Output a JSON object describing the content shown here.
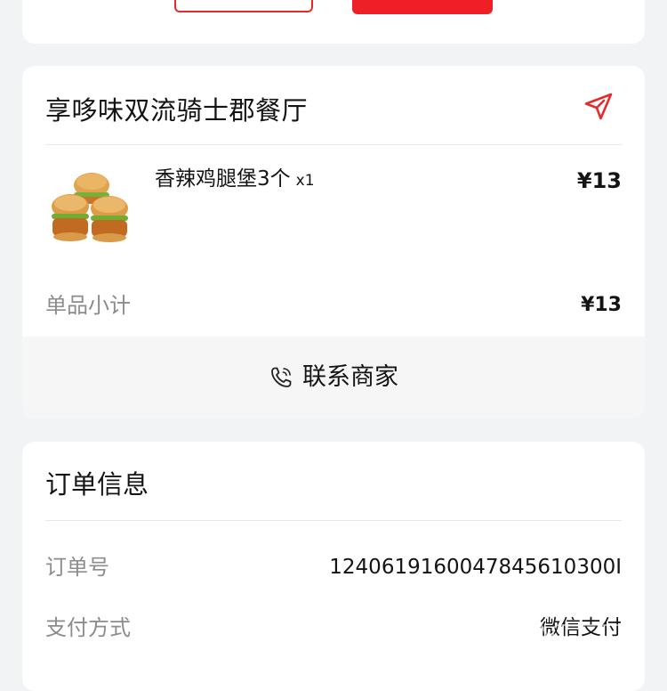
{
  "shop": {
    "name": "享哆味双流骑士郡餐厅",
    "item": {
      "name": "香辣鸡腿堡3个",
      "qty": "x1",
      "price": "¥13"
    },
    "subtotal_label": "单品小计",
    "subtotal_value": "¥13",
    "contact_label": "联系商家"
  },
  "order": {
    "title": "订单信息",
    "number_label": "订单号",
    "number_value": "1240619160047845610300I",
    "pay_label": "支付方式",
    "pay_value": "微信支付"
  },
  "icons": {
    "nav": "navigation-arrow-icon",
    "phone": "phone-icon",
    "food": "burger-food-image",
    "watermark": "dianping-watermark"
  },
  "colors": {
    "accent": "#ef1f26",
    "background": "#f2f3f5",
    "card": "#ffffff",
    "muted_text": "#8c8c8c"
  }
}
